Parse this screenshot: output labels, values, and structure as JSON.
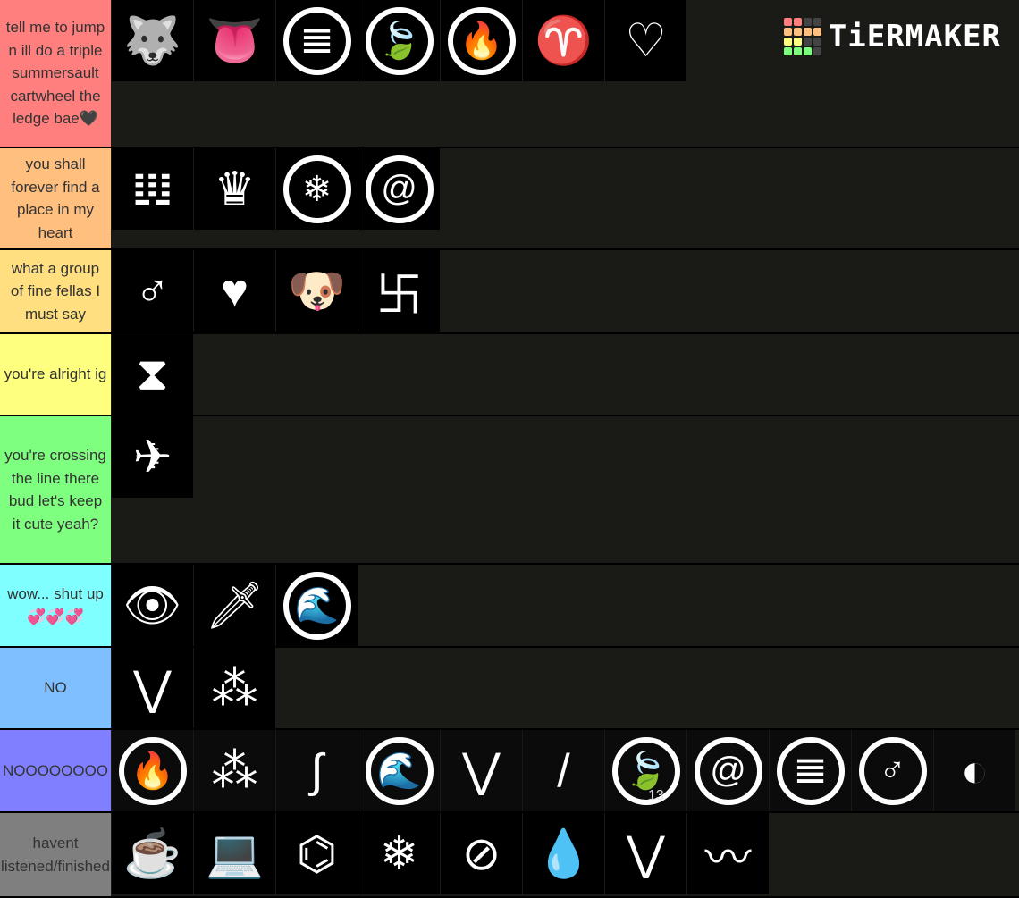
{
  "logo": {
    "text": "TiERMAKER"
  },
  "tiers": [
    {
      "label": "tell me to jump n ill do a triple summersault cartwheel the ledge bae🖤",
      "color": "#ff7f7f",
      "items": [
        {
          "icon": "howling-wolf-icon",
          "glyph": "🐺"
        },
        {
          "icon": "fanged-mouth-tongue-icon",
          "glyph": "👅"
        },
        {
          "icon": "fangs-circle-icon",
          "glyph": "𝌆",
          "circle": true
        },
        {
          "icon": "leaf-circle-icon",
          "glyph": "🍃",
          "circle": true
        },
        {
          "icon": "flame-circle-icon",
          "glyph": "🔥",
          "circle": true
        },
        {
          "icon": "pink-horns-icon",
          "glyph": "♈"
        },
        {
          "icon": "pizza-heart-icon",
          "glyph": "♡"
        }
      ]
    },
    {
      "label": "you shall forever find a place in my heart",
      "color": "#ffbf7f",
      "items": [
        {
          "icon": "vampire-fangs-icon",
          "glyph": "𝍕"
        },
        {
          "icon": "crown-icon",
          "glyph": "♛"
        },
        {
          "icon": "snowflake-circle-icon",
          "glyph": "❄",
          "circle": true
        },
        {
          "icon": "spiral-circle-icon",
          "glyph": "@",
          "circle": true
        }
      ]
    },
    {
      "label": "what a group of fine fellas I must say",
      "color": "#ffdf7f",
      "items": [
        {
          "icon": "male-symbol-icon",
          "glyph": "♂"
        },
        {
          "icon": "heartbeat-heart-icon",
          "glyph": "♥"
        },
        {
          "icon": "dog-face-icon",
          "glyph": "🐶"
        },
        {
          "icon": "maze-icon",
          "glyph": "卐"
        }
      ]
    },
    {
      "label": "you're alright ig",
      "color": "#ffff7f",
      "items": [
        {
          "icon": "hourglass-icon",
          "glyph": "⧗"
        }
      ]
    },
    {
      "label": "you're crossing the line there bud let's keep it cute yeah?",
      "color": "#7fff7f",
      "items": [
        {
          "icon": "rainbow-airplane-icon",
          "glyph": "✈"
        }
      ]
    },
    {
      "label": "wow... shut up💞💞💞",
      "color": "#7fffff",
      "items": [
        {
          "icon": "eye-icon",
          "glyph": "👁"
        },
        {
          "icon": "sword-circle-icon",
          "glyph": "🗡"
        },
        {
          "icon": "wave-circle-icon",
          "glyph": "🌊",
          "circle": true
        }
      ]
    },
    {
      "label": "NO",
      "color": "#7fbfff",
      "items": [
        {
          "icon": "grey-horns-icon",
          "glyph": "⋁"
        },
        {
          "icon": "jagged-teeth-icon",
          "glyph": "⁂"
        }
      ]
    },
    {
      "label": "NOOOOOOOO",
      "color": "#7f7fff",
      "items": [
        {
          "icon": "flame-circle-album-icon",
          "glyph": "🔥",
          "circle": true,
          "album": true
        },
        {
          "icon": "teeth-album-icon",
          "glyph": "⁂",
          "album": true
        },
        {
          "icon": "needle-thread-icon",
          "glyph": "∫",
          "album": true
        },
        {
          "icon": "wave-circle-album-icon",
          "glyph": "🌊",
          "circle": true,
          "album": true
        },
        {
          "icon": "red-horns-album-icon",
          "glyph": "⋁",
          "album": true
        },
        {
          "icon": "needle-album-icon",
          "glyph": "/",
          "album": true
        },
        {
          "icon": "leaf-circle-album-icon",
          "glyph": "🍃",
          "circle": true,
          "album": true,
          "num": "13"
        },
        {
          "icon": "spiral-circle-album-icon",
          "glyph": "@",
          "circle": true,
          "album": true
        },
        {
          "icon": "fangs-circle-album-icon",
          "glyph": "𝌆",
          "circle": true,
          "album": true
        },
        {
          "icon": "male-circle-album-icon",
          "glyph": "♂",
          "circle": true,
          "album": true
        },
        {
          "icon": "half-moon-album-icon",
          "glyph": "◐",
          "album": true
        }
      ]
    },
    {
      "label": "havent listened/finished",
      "color": "#7f7f7f",
      "items": [
        {
          "icon": "coffee-heart-mug-icon",
          "glyph": "☕"
        },
        {
          "icon": "laptop-hearts-icon",
          "glyph": "💻"
        },
        {
          "icon": "brain-molecule-icon",
          "glyph": "⌬"
        },
        {
          "icon": "aperture-snowflake-icon",
          "glyph": "❄"
        },
        {
          "icon": "crossed-eye-icon",
          "glyph": "⊘"
        },
        {
          "icon": "water-drop-circle-icon",
          "glyph": "💧"
        },
        {
          "icon": "purple-horns-icon",
          "glyph": "⋁"
        },
        {
          "icon": "wave-swoosh-icon",
          "glyph": "〰"
        }
      ]
    }
  ]
}
